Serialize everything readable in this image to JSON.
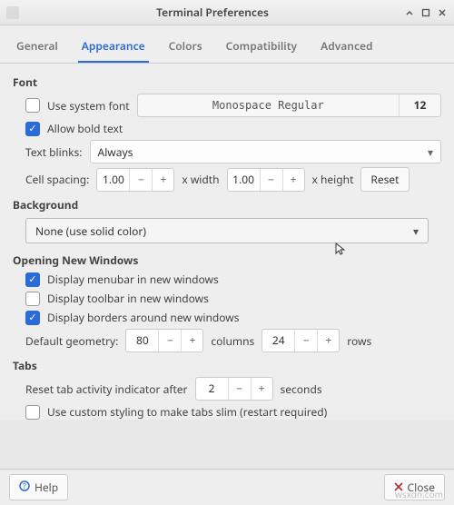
{
  "window": {
    "title": "Terminal Preferences"
  },
  "tabs": {
    "general": "General",
    "appearance": "Appearance",
    "colors": "Colors",
    "compat": "Compatibility",
    "advanced": "Advanced"
  },
  "font": {
    "section": "Font",
    "use_system": "Use system font",
    "font_name": "Monospace Regular",
    "font_size": "12",
    "allow_bold": "Allow bold text",
    "blinks_label": "Text blinks:",
    "blinks_value": "Always",
    "cellspacing_label": "Cell spacing:",
    "xwidth": "x width",
    "xheight": "x height",
    "w": "1.00",
    "h": "1.00",
    "reset": "Reset"
  },
  "background": {
    "section": "Background",
    "value": "None (use solid color)"
  },
  "newwin": {
    "section": "Opening New Windows",
    "menubar": "Display menubar in new windows",
    "toolbar": "Display toolbar in new windows",
    "borders": "Display borders around new windows",
    "geom_label": "Default geometry:",
    "cols": "80",
    "cols_label": "columns",
    "rows": "24",
    "rows_label": "rows"
  },
  "tabs_section": {
    "section": "Tabs",
    "reset_label": "Reset tab activity indicator after",
    "reset_val": "2",
    "seconds": "seconds",
    "slim": "Use custom styling to make tabs slim (restart required)"
  },
  "footer": {
    "help": "Help",
    "close": "Close"
  },
  "watermark": "wsxdn.com"
}
